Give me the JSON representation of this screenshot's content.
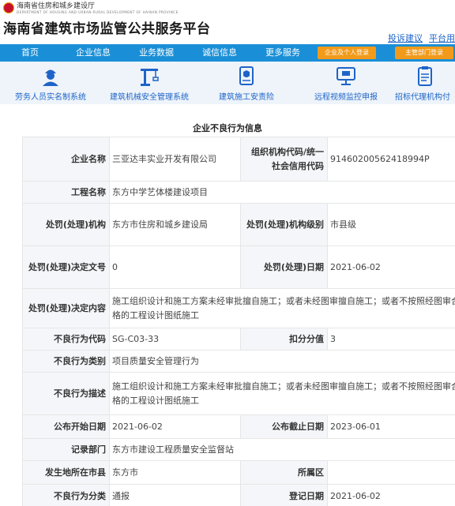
{
  "header": {
    "dept_name": "海南省住房和城乡建设厅",
    "dept_sub": "DEPARTMENT OF HOUSING AND URBAN-RURAL DEVELOPMENT OF HAINAN PROVINCE",
    "site_title": "海南省建筑市场监管公共服务平台",
    "link_complaint": "投诉建议",
    "link_platform": "平台用"
  },
  "nav": {
    "items": [
      "首页",
      "企业信息",
      "业务数据",
      "诚信信息",
      "更多服务"
    ],
    "login_enterprise": "企业及个人登录",
    "login_admin": "主管部门登录",
    "color": "#1a8fd7",
    "button_color": "#f29a1a"
  },
  "quick_links": [
    {
      "label": "劳务人员实名制系统",
      "icon": "worker-icon"
    },
    {
      "label": "建筑机械安全管理系统",
      "icon": "crane-icon"
    },
    {
      "label": "建筑施工安责险",
      "icon": "insurance-document-icon"
    },
    {
      "label": "远程视频监控申报",
      "icon": "monitor-icon"
    },
    {
      "label": "招标代理机构付",
      "icon": "clipboard-icon"
    }
  ],
  "record": {
    "section_title": "企业不良行为信息",
    "labels": {
      "company": "企业名称",
      "org_code": "组织机构代码/统一社会信用代码",
      "project": "工程名称",
      "authority": "处罚(处理)机构",
      "authority_level": "处罚(处理)机构级别",
      "decision_no": "处罚(处理)决定文号",
      "penalty_date": "处罚(处理)日期",
      "decision_content": "处罚(处理)决定内容",
      "behavior_code": "不良行为代码",
      "deduct": "扣分分值",
      "category": "不良行为类别",
      "description": "不良行为描述",
      "pub_start": "公布开始日期",
      "pub_end": "公布截止日期",
      "record_dept": "记录部门",
      "city": "发生地所在市县",
      "district": "所属区",
      "classification": "不良行为分类",
      "register_date": "登记日期"
    },
    "values": {
      "company": "三亚达丰实业开发有限公司",
      "org_code": "91460200562418994P",
      "project": "东方中学艺体楼建设项目",
      "authority": "东方市住房和城乡建设局",
      "authority_level": "市县级",
      "decision_no": "0",
      "penalty_date": "2021-06-02",
      "decision_content": "施工组织设计和施工方案未经审批擅自施工；或者未经图审擅自施工；或者不按照经图审合格的工程设计图纸施工",
      "behavior_code": "SG-C03-33",
      "deduct": "3",
      "category": "项目质量安全管理行为",
      "description": "施工组织设计和施工方案未经审批擅自施工；或者未经图审擅自施工；或者不按照经图审合格的工程设计图纸施工",
      "pub_start": "2021-06-02",
      "pub_end": "2023-06-01",
      "record_dept": "东方市建设工程质量安全监督站",
      "city": "东方市",
      "district": "",
      "classification": "通报",
      "register_date": "2021-06-02"
    }
  }
}
